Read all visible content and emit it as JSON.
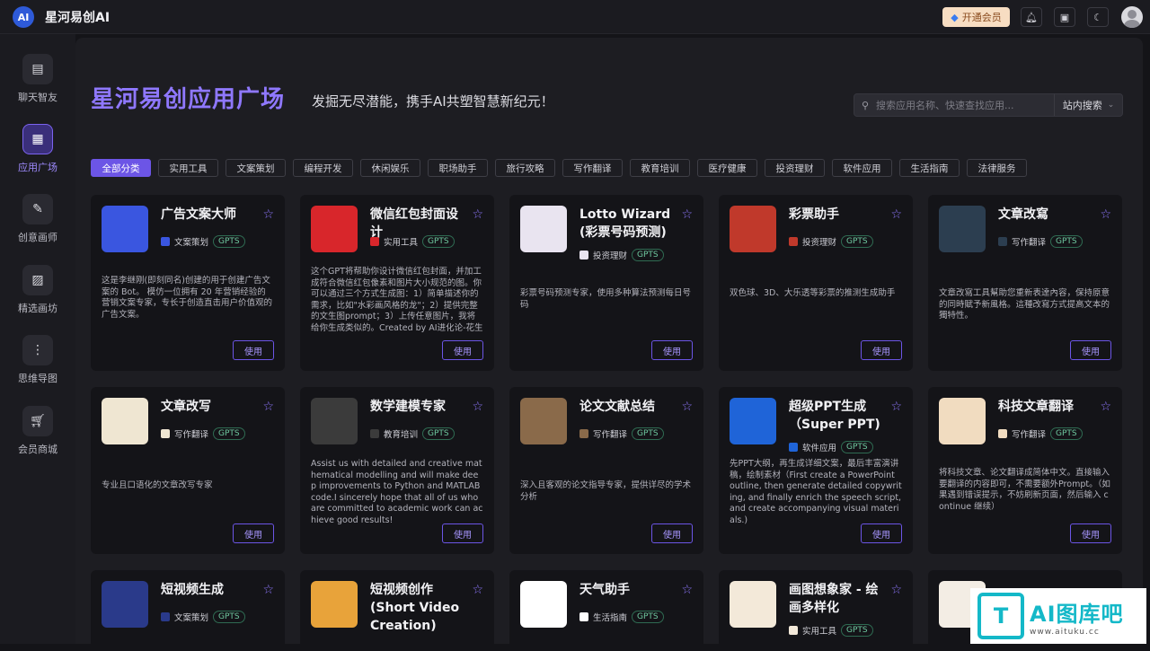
{
  "app": {
    "brand": "星河易创AI",
    "logo_text": "AI"
  },
  "topbar": {
    "vip_label": "开通会员"
  },
  "sidebar": {
    "items": [
      {
        "label": "聊天智友",
        "icon": "chat-icon"
      },
      {
        "label": "应用广场",
        "icon": "grid-icon",
        "active": true
      },
      {
        "label": "创意画师",
        "icon": "palette-icon"
      },
      {
        "label": "精选画坊",
        "icon": "image-icon"
      },
      {
        "label": "思维导图",
        "icon": "mindmap-icon"
      },
      {
        "label": "会员商城",
        "icon": "cart-icon"
      }
    ]
  },
  "hero": {
    "title": "星河易创应用广场",
    "subtitle": "发掘无尽潜能，携手AI共塑智慧新纪元！"
  },
  "search": {
    "placeholder": "搜索应用名称、快速查找应用...",
    "scope": "站内搜索"
  },
  "categories": [
    "全部分类",
    "实用工具",
    "文案策划",
    "编程开发",
    "休闲娱乐",
    "职场助手",
    "旅行攻略",
    "写作翻译",
    "教育培训",
    "医疗健康",
    "投资理财",
    "软件应用",
    "生活指南",
    "法律服务"
  ],
  "cards": [
    {
      "title": "广告文案大师",
      "category": "文案策划",
      "badge": "GPTS",
      "desc": "这是李继刚(即刻同名)创建的用于创建广告文案的 Bot。 模仿一位拥有 20 年营销经验的营销文案专家，专长于创造直击用户价值观的广告文案。",
      "button": "使用",
      "thumb_color": "#3a56e0"
    },
    {
      "title": "微信红包封面设计",
      "category": "实用工具",
      "badge": "GPTS",
      "desc": "这个GPT将帮助你设计微信红包封面，并加工成符合微信红包像素和图片大小规范的图。你可以通过三个方式生成图：1）简单描述你的需求，比如\"水彩画风格的龙\"；2）提供完整的文生图prompt；3）上传任意图片，我将给你生成类似的。Created by AI进化论-花生",
      "button": "使用",
      "thumb_color": "#d8262b"
    },
    {
      "title": "Lotto Wizard (彩票号码预测)",
      "category": "投资理财",
      "badge": "GPTS",
      "desc": "彩票号码预测专家，使用多种算法预测每日号码",
      "button": "使用",
      "thumb_color": "#e9e4f0"
    },
    {
      "title": "彩票助手",
      "category": "投资理财",
      "badge": "GPTS",
      "desc": "双色球、3D、大乐透等彩票的推测生成助手",
      "button": "使用",
      "thumb_color": "#c0392b"
    },
    {
      "title": "文章改寫",
      "category": "写作翻译",
      "badge": "GPTS",
      "desc": "文章改寫工具幫助您重新表達內容，保持原意的同時賦予新風格。這種改寫方式提高文本的獨特性。",
      "button": "使用",
      "thumb_color": "#2c3e50"
    },
    {
      "title": "文章改写",
      "category": "写作翻译",
      "badge": "GPTS",
      "desc": "专业且口语化的文章改写专家",
      "button": "使用",
      "thumb_color": "#efe6d2"
    },
    {
      "title": "数学建模专家",
      "category": "教育培训",
      "badge": "GPTS",
      "desc": "Assist us with detailed and creative mathematical modelling and will make deep improvements to Python and MATLAB code.I sincerely hope that all of us who are committed to academic work can achieve good results!",
      "button": "使用",
      "thumb_color": "#3b3b3b"
    },
    {
      "title": "论文文献总结",
      "category": "写作翻译",
      "badge": "GPTS",
      "desc": "深入且客观的论文指导专家，提供详尽的学术分析",
      "button": "使用",
      "thumb_color": "#8a6a4a"
    },
    {
      "title": "超级PPT生成（Super PPT)",
      "category": "软件应用",
      "badge": "GPTS",
      "desc": "先PPT大纲，再生成详细文案，最后丰富演讲稿，绘制素材（First create a PowerPoint outline, then generate detailed copywriting, and finally enrich the speech script, and create accompanying visual materials.)",
      "button": "使用",
      "thumb_color": "#1f64d8"
    },
    {
      "title": "科技文章翻译",
      "category": "写作翻译",
      "badge": "GPTS",
      "desc": "将科技文章、论文翻译成简体中文。直接输入要翻译的内容即可，不需要额外Prompt。（如果遇到错误提示，不妨刷新页面，然后输入 continue 继续）",
      "button": "使用",
      "thumb_color": "#f1dcc0"
    },
    {
      "title": "短视频生成",
      "category": "文案策划",
      "badge": "GPTS",
      "thumb_color": "#2a3a8a"
    },
    {
      "title": "短视频创作(Short Video Creation)",
      "category": "",
      "badge": "",
      "thumb_color": "#e8a33a"
    },
    {
      "title": "天气助手",
      "category": "生活指南",
      "badge": "GPTS",
      "thumb_color": "#ffffff"
    },
    {
      "title": "画图想象家 - 绘画多样化",
      "category": "实用工具",
      "badge": "GPTS",
      "thumb_color": "#f3e9d9"
    },
    {
      "title": "",
      "category": "",
      "badge": "",
      "thumb_color": "#f3ede4"
    }
  ],
  "watermark": {
    "mark": "T",
    "title": "AI图库吧",
    "url": "www.aituku.cc"
  }
}
